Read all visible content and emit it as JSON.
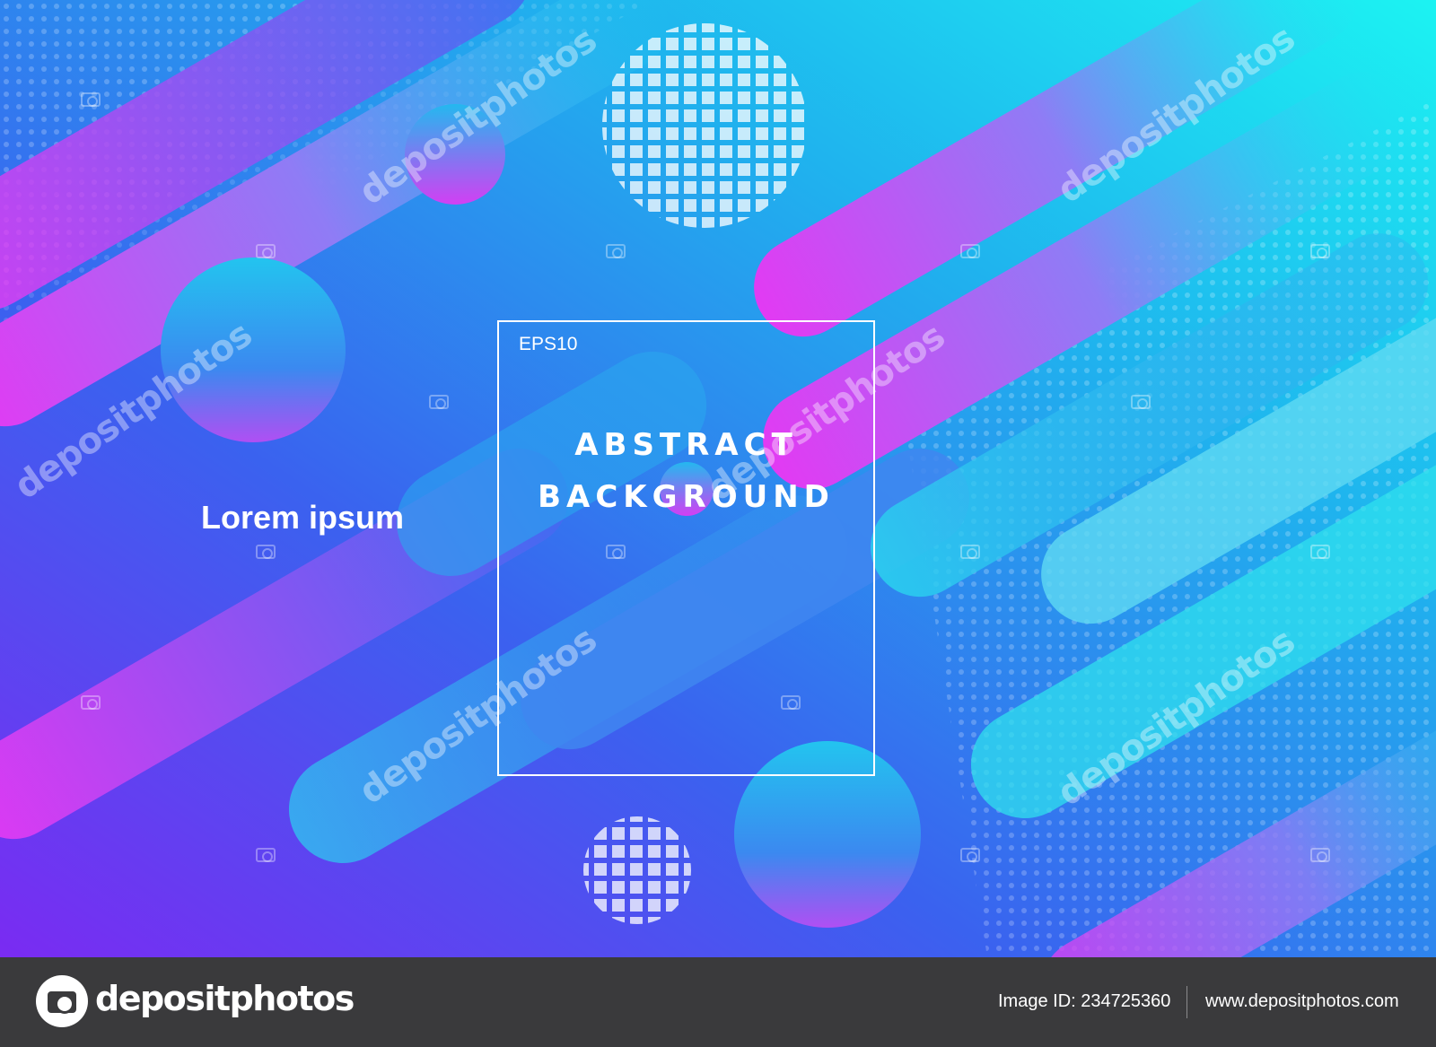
{
  "artwork": {
    "eps_label": "EPS10",
    "headline_line1": "ABSTRACT",
    "headline_line2": "BACKGROUND",
    "subtitle": "Lorem ipsum",
    "watermark_text": "depositphotos",
    "colors": {
      "gradient_violet": "#7b2cf5",
      "gradient_blue": "#2f6ef0",
      "gradient_cyan": "#1ef0f4",
      "accent_magenta": "#e936f2",
      "frame_white": "#ffffff"
    }
  },
  "footer": {
    "brand_name": "depositphotos",
    "brand_icon": "camera-logo-icon",
    "image_id": "Image ID: 234725360",
    "site_url": "www.depositphotos.com"
  }
}
